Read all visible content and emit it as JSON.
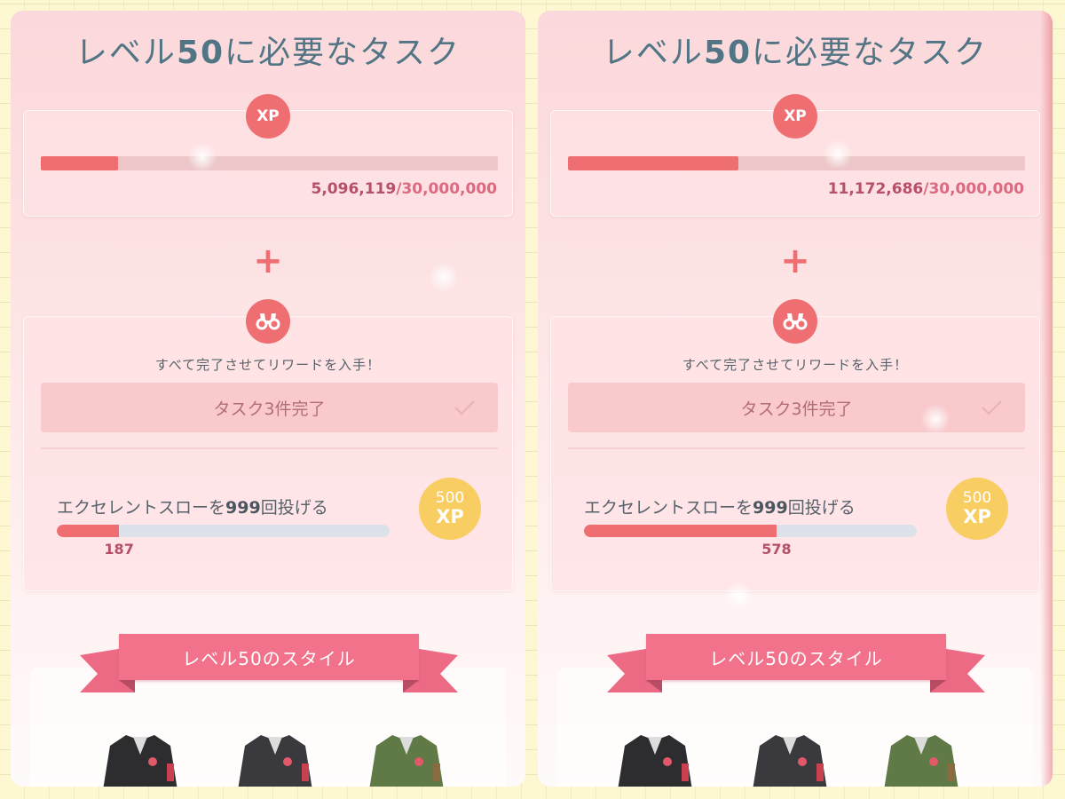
{
  "panels": [
    {
      "title_prefix": "レベル",
      "title_number": "50",
      "title_suffix": "に必要なタスク",
      "xp_badge": "XP",
      "xp_progress": 0.1699,
      "xp_current": "5,096,119",
      "xp_goal": "/30,000,000",
      "plus": "+",
      "reward_instruction": "すべて完了させてリワードを入手！",
      "tasks_completed": "タスク3件完了",
      "task_prefix": "エクセレントスローを",
      "task_number": "999",
      "task_suffix": "回投げる",
      "task_progress": 0.187,
      "task_count": "187",
      "reward_amount": "500",
      "reward_unit": "XP",
      "style_banner": "レベル50のスタイル"
    },
    {
      "title_prefix": "レベル",
      "title_number": "50",
      "title_suffix": "に必要なタスク",
      "xp_badge": "XP",
      "xp_progress": 0.3724,
      "xp_current": "11,172,686",
      "xp_goal": "/30,000,000",
      "plus": "+",
      "reward_instruction": "すべて完了させてリワードを入手！",
      "tasks_completed": "タスク3件完了",
      "task_prefix": "エクセレントスローを",
      "task_number": "999",
      "task_suffix": "回投げる",
      "task_progress": 0.5786,
      "task_count": "578",
      "reward_amount": "500",
      "reward_unit": "XP",
      "style_banner": "レベル50のスタイル"
    }
  ],
  "icons": {
    "binoculars": "binoculars-icon",
    "check": "checkmark-icon",
    "jackets": [
      "black-jacket-image",
      "black-jacket-image",
      "green-jacket-image"
    ]
  },
  "colors": {
    "accent": "#ef6e72",
    "title": "#527585",
    "ribbon": "#f1728a",
    "reward_badge": "#f8cd62",
    "progress_track": "#dde2ea"
  }
}
